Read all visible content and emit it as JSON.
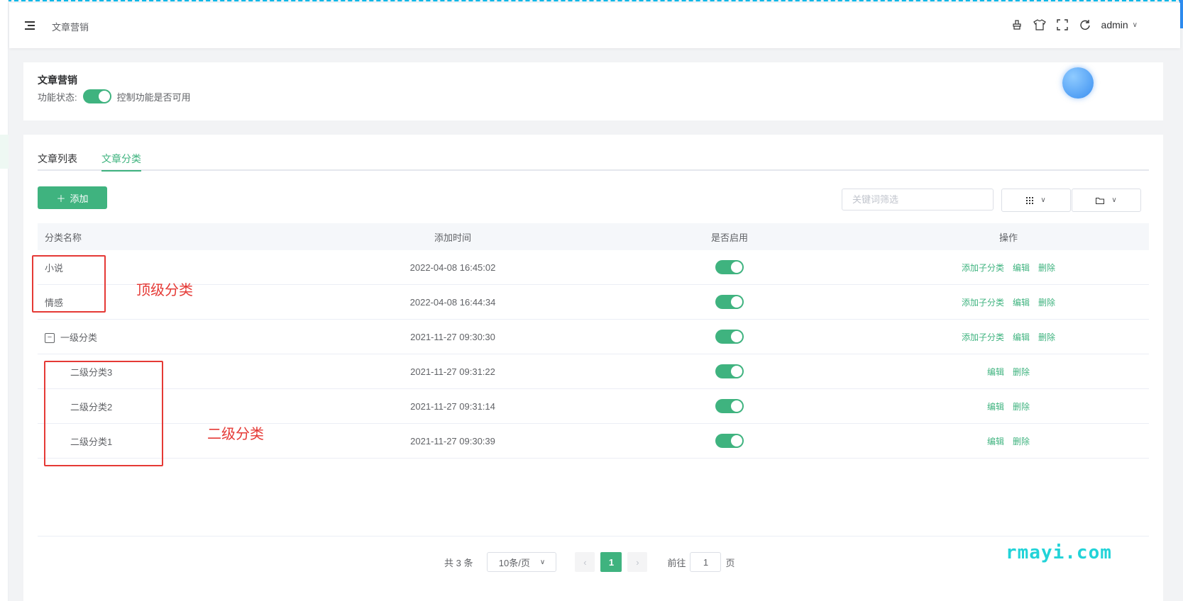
{
  "header": {
    "breadcrumb": "文章营销",
    "user": "admin",
    "icons": [
      "brush-icon",
      "shirt-icon",
      "fullscreen-icon",
      "refresh-icon"
    ]
  },
  "feature": {
    "title": "文章营销",
    "status_label": "功能状态:",
    "status_desc": "控制功能是否可用",
    "enabled": true
  },
  "tabs": [
    {
      "label": "文章列表",
      "active": false
    },
    {
      "label": "文章分类",
      "active": true
    }
  ],
  "toolbar": {
    "add_label": "添加",
    "search_placeholder": "关键词筛选"
  },
  "table": {
    "columns": [
      "分类名称",
      "添加时间",
      "是否启用",
      "操作"
    ],
    "rows": [
      {
        "name": "小说",
        "time": "2022-04-08 16:45:02",
        "enabled": true,
        "ops": [
          "添加子分类",
          "编辑",
          "删除"
        ],
        "level": 0
      },
      {
        "name": "情感",
        "time": "2022-04-08 16:44:34",
        "enabled": true,
        "ops": [
          "添加子分类",
          "编辑",
          "删除"
        ],
        "level": 0
      },
      {
        "name": "一级分类",
        "time": "2021-11-27 09:30:30",
        "enabled": true,
        "ops": [
          "添加子分类",
          "编辑",
          "删除"
        ],
        "level": 0,
        "expand": "−"
      },
      {
        "name": "二级分类3",
        "time": "2021-11-27 09:31:22",
        "enabled": true,
        "ops": [
          "编辑",
          "删除"
        ],
        "level": 1
      },
      {
        "name": "二级分类2",
        "time": "2021-11-27 09:31:14",
        "enabled": true,
        "ops": [
          "编辑",
          "删除"
        ],
        "level": 1
      },
      {
        "name": "二级分类1",
        "time": "2021-11-27 09:30:39",
        "enabled": true,
        "ops": [
          "编辑",
          "删除"
        ],
        "level": 1
      }
    ]
  },
  "pagination": {
    "total": "共 3 条",
    "page_size": "10条/页",
    "current": "1",
    "goto_label": "前往",
    "goto_value": "1",
    "page_suffix": "页"
  },
  "annotations": {
    "top_level": "顶级分类",
    "second_level": "二级分类"
  },
  "watermark": "rmayi.com",
  "colors": {
    "accent": "#3fb37f",
    "annotation": "#e53935"
  }
}
